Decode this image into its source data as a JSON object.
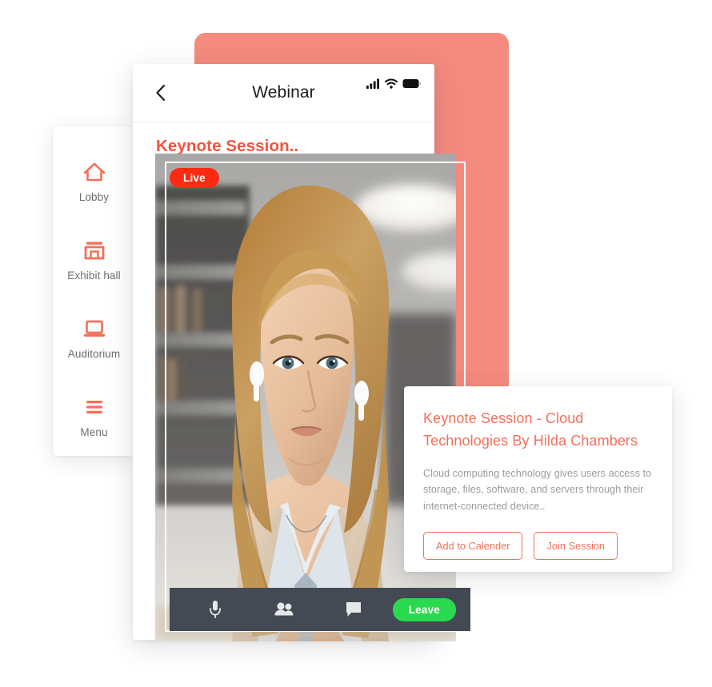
{
  "sidebar": {
    "items": [
      {
        "label": "Lobby",
        "icon": "home-icon"
      },
      {
        "label": "Exhibit hall",
        "icon": "storefront-icon"
      },
      {
        "label": "Auditorium",
        "icon": "laptop-icon"
      },
      {
        "label": "Menu",
        "icon": "hamburger-menu-icon"
      }
    ]
  },
  "phone": {
    "title": "Webinar",
    "back_icon": "chevron-left-icon",
    "status": {
      "signal_icon": "cellular-signal-icon",
      "wifi_icon": "wifi-icon",
      "battery_icon": "battery-full-icon"
    },
    "session_heading": "Keynote Session.."
  },
  "video": {
    "live_badge": "Live",
    "controls": {
      "mic_icon": "microphone-icon",
      "participants_icon": "people-icon",
      "chat_icon": "chat-bubble-icon",
      "leave_label": "Leave"
    }
  },
  "info_card": {
    "title_line1": "Keynote Session - Cloud",
    "title_line2": "Technologies  By Hilda Chambers",
    "description": "Cloud computing technology gives users access to storage, files, software, and servers through their internet-connected device..",
    "primary_action": "Add to Calender",
    "secondary_action": "Join Session"
  },
  "colors": {
    "salmon": "#F58A7E",
    "coral": "#F4705A",
    "coral_dark": "#F4543C",
    "live_red": "#FA2B12",
    "leave_green": "#2BD94F",
    "control_bar": "#434A54",
    "label_gray": "#6d6d72"
  }
}
